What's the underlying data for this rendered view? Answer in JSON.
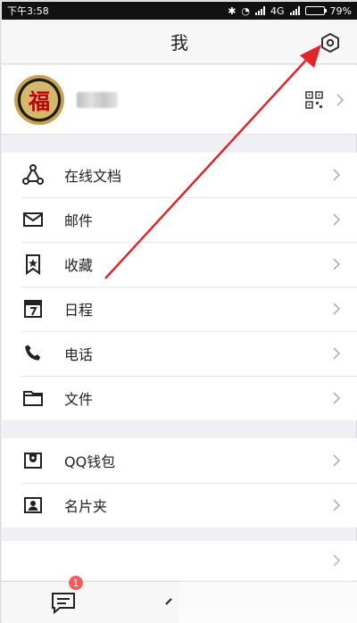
{
  "status_bar": {
    "time": "下午3:58",
    "network": "4G",
    "battery": "79%",
    "battery_level": 0.79
  },
  "header": {
    "title": "我"
  },
  "profile": {
    "avatar_char": "福"
  },
  "menu": {
    "group1": [
      {
        "label": "在线文档",
        "icon": "share-nodes-icon"
      },
      {
        "label": "邮件",
        "icon": "mail-icon"
      },
      {
        "label": "收藏",
        "icon": "bookmark-star-icon"
      },
      {
        "label": "日程",
        "icon": "calendar-icon"
      },
      {
        "label": "电话",
        "icon": "phone-icon"
      },
      {
        "label": "文件",
        "icon": "folder-icon"
      }
    ],
    "group2": [
      {
        "label": "QQ钱包",
        "icon": "wallet-icon"
      },
      {
        "label": "名片夹",
        "icon": "card-holder-icon"
      }
    ]
  },
  "tab_bar": {
    "messages_badge": "1"
  },
  "colors": {
    "annotation_arrow": "#e0262b",
    "badge": "#f65a5b"
  }
}
